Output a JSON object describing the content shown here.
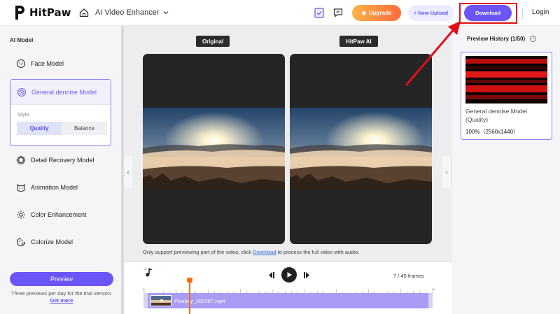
{
  "header": {
    "app_name": "HitPaw",
    "product": "AI Video Enhancer",
    "upgrade_label": "Upgrade",
    "new_upload_label": "+ New Upload",
    "download_label": "Download",
    "login_label": "Login",
    "icons": [
      "home-icon",
      "task-list-icon",
      "feedback-icon",
      "gem-icon",
      "chevron-down-icon"
    ]
  },
  "sidebar": {
    "title": "AI Model",
    "items": [
      {
        "label": "Face Model",
        "icon": "face-icon"
      },
      {
        "label": "General denoise Model",
        "icon": "denoise-icon",
        "selected": true
      },
      {
        "label": "Detail Recovery Model",
        "icon": "detail-icon"
      },
      {
        "label": "Animation Model",
        "icon": "animation-icon"
      },
      {
        "label": "Color Enhancement",
        "icon": "color-icon"
      },
      {
        "label": "Colorize Model",
        "icon": "colorize-icon"
      }
    ],
    "style_label": "Style",
    "style_options": [
      "Quality",
      "Balance"
    ],
    "style_selected": "Quality",
    "preview_label": "Preview",
    "trial_note": "Three previews per day for the trial version.",
    "get_more_label": "Get more"
  },
  "main": {
    "original_label": "Original",
    "ai_label": "HitPaw AI",
    "notice_before": "Only support previewing part of the video, click ",
    "notice_link": "Download",
    "notice_after": " to process the full video with audio."
  },
  "timeline": {
    "frames_label": "7 / 45 frames",
    "ruler_start": "0",
    "ruler_end": "45",
    "clip_name": "Pixabay_260397.mp4",
    "playhead_frame": 7,
    "total_frames": 45
  },
  "preview_history": {
    "title": "Preview History (1/50)",
    "item_name": "General denoise Model (Quality)",
    "item_meta": "100%（2560x1440）"
  },
  "colors": {
    "accent": "#6b55f6",
    "upgrade_gradient": [
      "#ffb347",
      "#ff6a3d"
    ],
    "highlight_red": "#e0101a",
    "playhead": "#f56e12"
  }
}
